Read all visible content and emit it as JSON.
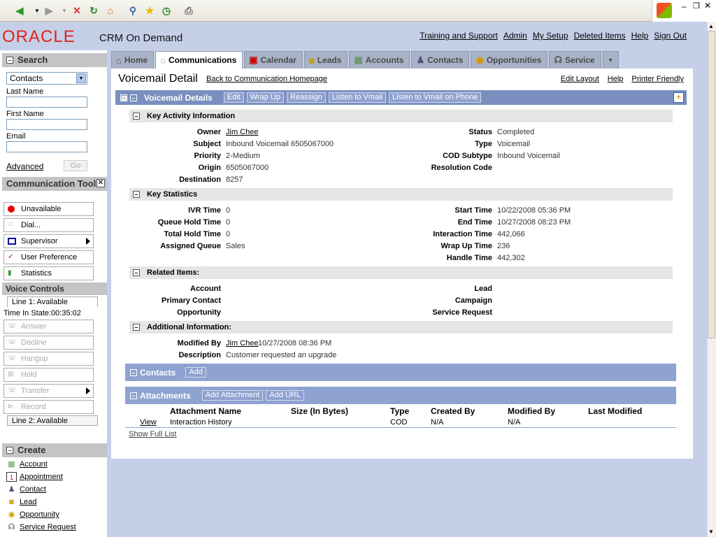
{
  "app": {
    "brand": "ORACLE",
    "product": "CRM On Demand"
  },
  "global_links": [
    "Training and Support",
    "Admin",
    "My Setup",
    "Deleted Items",
    "Help",
    "Sign Out"
  ],
  "search": {
    "title": "Search",
    "type_selected": "Contacts",
    "last_name_label": "Last Name",
    "first_name_label": "First Name",
    "email_label": "Email",
    "advanced_label": "Advanced",
    "go_label": "Go"
  },
  "comm_tools": {
    "title": "Communication Tools",
    "items": [
      "Unavailable",
      "Dial...",
      "Supervisor",
      "User Preference",
      "Statistics"
    ]
  },
  "voice_controls": {
    "title": "Voice Controls",
    "line1": "Line 1: Available",
    "time_in_state": "Time In State:00:35:02",
    "buttons": [
      "Answer",
      "Decline",
      "Hangup",
      "Hold",
      "Transfer",
      "Record"
    ],
    "line2": "Line 2: Available"
  },
  "create": {
    "title": "Create",
    "items": [
      "Account",
      "Appointment",
      "Contact",
      "Lead",
      "Opportunity",
      "Service Request"
    ]
  },
  "tabs": [
    "Home",
    "Communications",
    "Calendar",
    "Leads",
    "Accounts",
    "Contacts",
    "Opportunities",
    "Service"
  ],
  "page": {
    "title": "Voicemail Detail",
    "back_link": "Back to Communication Homepage",
    "links": [
      "Edit Layout",
      "Help",
      "Printer Friendly"
    ]
  },
  "details_bar": {
    "title": "Voicemail Details",
    "buttons": [
      "Edit",
      "Wrap Up",
      "Reassign",
      "Listen to Vmail",
      "Listen to Vmail on Phone"
    ]
  },
  "key_activity": {
    "title": "Key Activity Information",
    "left": [
      {
        "label": "Owner",
        "value": "Jim Chee"
      },
      {
        "label": "Subject",
        "value": "Inbound Voicemail 6505067000"
      },
      {
        "label": "Priority",
        "value": "2-Medium"
      },
      {
        "label": "Origin",
        "value": "6505067000"
      },
      {
        "label": "Destination",
        "value": "8257"
      }
    ],
    "right": [
      {
        "label": "Status",
        "value": "Completed"
      },
      {
        "label": "Type",
        "value": "Voicemail"
      },
      {
        "label": "COD Subtype",
        "value": "Inbound Voicemail"
      },
      {
        "label": "Resolution Code",
        "value": ""
      }
    ]
  },
  "key_stats": {
    "title": "Key Statistics",
    "left": [
      {
        "label": "IVR Time",
        "value": "0"
      },
      {
        "label": "Queue Hold Time",
        "value": "0"
      },
      {
        "label": "Total Hold Time",
        "value": "0"
      },
      {
        "label": "Assigned Queue",
        "value": "Sales"
      }
    ],
    "right": [
      {
        "label": "Start Time",
        "value": "10/22/2008 05:36 PM"
      },
      {
        "label": "End Time",
        "value": "10/27/2008 08:23 PM"
      },
      {
        "label": "Interaction Time",
        "value": "442,066"
      },
      {
        "label": "Wrap Up Time",
        "value": "236"
      },
      {
        "label": "Handle Time",
        "value": "442,302"
      }
    ]
  },
  "related": {
    "title": "Related Items:",
    "left": [
      "Account",
      "Primary Contact",
      "Opportunity"
    ],
    "right": [
      "Lead",
      "Campaign",
      "Service Request"
    ]
  },
  "additional": {
    "title": "Additional Information:",
    "modified_by_label": "Modified By",
    "modified_by_user": "Jim Chee",
    "modified_by_date": "10/27/2008 08:36 PM",
    "description_label": "Description",
    "description_value": "Customer requested an upgrade"
  },
  "contacts_bar": {
    "title": "Contacts",
    "add_label": "Add"
  },
  "attachments": {
    "title": "Attachments",
    "add_attachment_label": "Add Attachment",
    "add_url_label": "Add URL",
    "columns": [
      "Attachment Name",
      "Size (In Bytes)",
      "Type",
      "Created By",
      "Modified By",
      "Last Modified"
    ],
    "row": {
      "action": "View",
      "name": "Interaction History",
      "size": "",
      "type": "COD",
      "created_by": "N/A",
      "modified_by": "N/A",
      "last_modified": ""
    },
    "show_full_list": "Show Full List"
  }
}
